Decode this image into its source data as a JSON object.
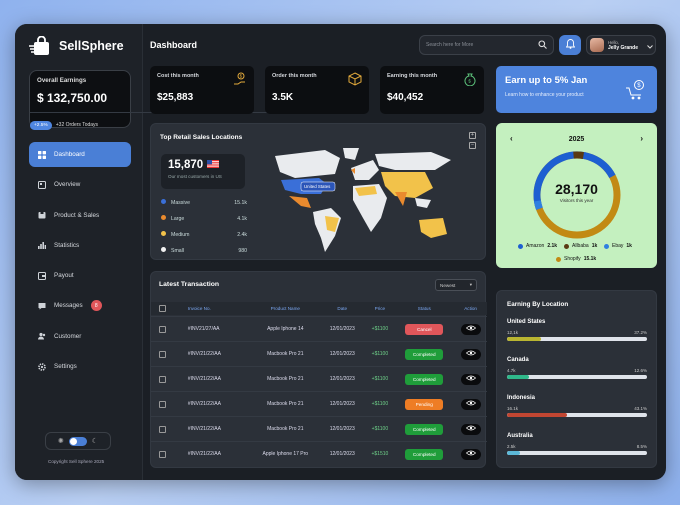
{
  "brand": {
    "name": "SellSphere"
  },
  "earnings": {
    "title": "Overall Earnings",
    "value": "$ 132,750.00",
    "change": "+2.5%",
    "orders": "+32 Orders Todays"
  },
  "nav": {
    "items": [
      {
        "label": "Dashboard",
        "icon": "grid-icon"
      },
      {
        "label": "Overview",
        "icon": "overview-icon"
      },
      {
        "label": "Product & Sales",
        "icon": "box-icon"
      },
      {
        "label": "Statistics",
        "icon": "bar-chart-icon"
      },
      {
        "label": "Payout",
        "icon": "wallet-icon"
      },
      {
        "label": "Messages",
        "icon": "message-icon",
        "badge": "8"
      },
      {
        "label": "Customer",
        "icon": "users-icon"
      },
      {
        "label": "Settings",
        "icon": "gear-icon"
      }
    ]
  },
  "footer": {
    "copyright": "Copyright Sell Sphere 2025"
  },
  "header": {
    "title": "Dashboard",
    "search_placeholder": "Search here for More",
    "user_greeting": "Hello,",
    "user_name": "Jelly Grande"
  },
  "stats": [
    {
      "title": "Cost this month",
      "value": "$25,883"
    },
    {
      "title": "Order this month",
      "value": "3.5K"
    },
    {
      "title": "Earning this month",
      "value": "$40,452"
    }
  ],
  "promo": {
    "title": "Earn up to 5% Jan",
    "subtitle": "Learn how to enhance your product"
  },
  "map": {
    "title": "Top Retail Sales Locations",
    "visitors": "15,870",
    "visitors_label": "Our most customers in US",
    "tooltip": "United States",
    "legend": [
      {
        "label": "Massive",
        "value": "15.1k",
        "color": "#3a6fd8"
      },
      {
        "label": "Large",
        "value": "4.1k",
        "color": "#e98a2e"
      },
      {
        "label": "Medium",
        "value": "2.4k",
        "color": "#f2c24a"
      },
      {
        "label": "Small",
        "value": "980",
        "color": "#f2f2f2"
      }
    ]
  },
  "transactions": {
    "title": "Latest Transaction",
    "sort": "Newest",
    "columns": [
      "Invoice No.",
      "Product Name",
      "Date",
      "Price",
      "Status",
      "Action"
    ],
    "rows": [
      {
        "invoice": "#INV21/27/AA",
        "product": "Apple Iphone 14",
        "date": "12/01/2023",
        "price": "+$1100",
        "status": "Cancel",
        "status_color": "#e0565a"
      },
      {
        "invoice": "#INV/21/22/AA",
        "product": "Macbook Pro 21",
        "date": "12/01/2023",
        "price": "+$1100",
        "status": "Completed",
        "status_color": "#1f9d3a"
      },
      {
        "invoice": "#INV/21/22/AA",
        "product": "Macbook Pro 21",
        "date": "12/01/2023",
        "price": "+$1100",
        "status": "Completed",
        "status_color": "#1f9d3a"
      },
      {
        "invoice": "#INV/21/22/AA",
        "product": "Macbook Pro 21",
        "date": "12/01/2023",
        "price": "+$1100",
        "status": "Pending",
        "status_color": "#ee7d25"
      },
      {
        "invoice": "#INV/21/22/AA",
        "product": "Macbook Pro 21",
        "date": "12/01/2023",
        "price": "+$1100",
        "status": "Completed",
        "status_color": "#1f9d3a"
      },
      {
        "invoice": "#INV/21/22/AA",
        "product": "Apple Iphone 17 Pro",
        "date": "12/01/2023",
        "price": "+$1510",
        "status": "Completed",
        "status_color": "#1f9d3a"
      }
    ]
  },
  "visitors": {
    "year": "2025",
    "value": "28,170",
    "label": "Visitors this year",
    "legend": [
      {
        "label": "Amazon",
        "value": "2.1k",
        "color": "#1d5fd1"
      },
      {
        "label": "Allbaba",
        "value": "1k",
        "color": "#5a3a12"
      },
      {
        "label": "Ebay",
        "value": "1k",
        "color": "#2f7fe0"
      },
      {
        "label": "Shopify",
        "value": "15.1k",
        "color": "#c28a14"
      }
    ]
  },
  "earning_locations": {
    "title": "Earning By Location",
    "items": [
      {
        "country": "United States",
        "left": "12,1k",
        "right": "37.2%",
        "fill": 0.24,
        "color": "#b9b531"
      },
      {
        "country": "Canada",
        "left": "4.7k",
        "right": "12.6%",
        "fill": 0.16,
        "color": "#2fb88a"
      },
      {
        "country": "Indonesia",
        "left": "16.1k",
        "right": "43.1%",
        "fill": 0.43,
        "color": "#c24632"
      },
      {
        "country": "Australia",
        "left": "2.5k",
        "right": "8.5%",
        "fill": 0.09,
        "color": "#5cb8d8"
      }
    ]
  }
}
